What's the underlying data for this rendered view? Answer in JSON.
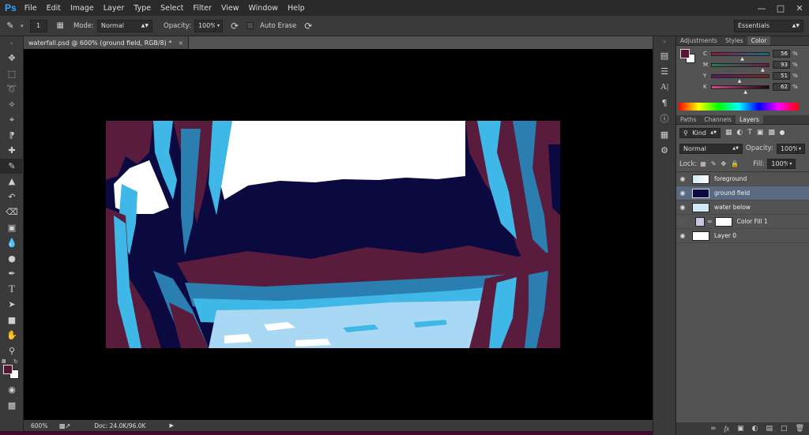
{
  "app": {
    "logo": "Ps"
  },
  "menu": [
    "File",
    "Edit",
    "Image",
    "Layer",
    "Type",
    "Select",
    "Filter",
    "View",
    "Window",
    "Help"
  ],
  "window_controls": {
    "minimize": "—",
    "maximize": "□",
    "close": "✕"
  },
  "options_bar": {
    "brush_size": "1",
    "mode_label": "Mode:",
    "mode_value": "Normal",
    "opacity_label": "Opacity:",
    "opacity_value": "100%",
    "auto_erase_label": "Auto Erase",
    "workspace": "Essentials"
  },
  "document": {
    "tab_title": "waterfall.psd @ 600% (ground field, RGB/8) *"
  },
  "status": {
    "zoom": "600%",
    "doc_info": "Doc: 24.0K/96.0K"
  },
  "color_panel": {
    "tabs": [
      "Adjustments",
      "Styles",
      "Color"
    ],
    "active_tab": "Color",
    "sliders": [
      {
        "channel": "C",
        "value": "56",
        "percent_value": 56
      },
      {
        "channel": "M",
        "value": "93",
        "percent_value": 93
      },
      {
        "channel": "Y",
        "value": "51",
        "percent_value": 51
      },
      {
        "channel": "K",
        "value": "62",
        "percent_value": 62
      }
    ],
    "percent_sign": "%",
    "foreground_color": "#5a1436",
    "background_color": "#ffffff"
  },
  "layers_panel": {
    "tabs": [
      "Paths",
      "Channels",
      "Layers"
    ],
    "active_tab": "Layers",
    "filter_label": "Kind",
    "blend_mode": "Normal",
    "opacity_label": "Opacity:",
    "opacity_value": "100%",
    "lock_label": "Lock:",
    "fill_label": "Fill:",
    "fill_value": "100%",
    "layers": [
      {
        "name": "foreground",
        "visible": true,
        "selected": false
      },
      {
        "name": "ground field",
        "visible": true,
        "selected": true
      },
      {
        "name": "water below",
        "visible": true,
        "selected": false
      },
      {
        "name": "Color Fill 1",
        "visible": false,
        "selected": false
      },
      {
        "name": "Layer 0",
        "visible": true,
        "selected": false
      }
    ]
  },
  "colors": {
    "accent": "#31a8ff",
    "art_navy": "#0a0a40",
    "art_maroon": "#5a1c3c",
    "art_cyan": "#3fb8e8",
    "art_lightblue": "#a8d8f4",
    "art_white": "#ffffff"
  }
}
